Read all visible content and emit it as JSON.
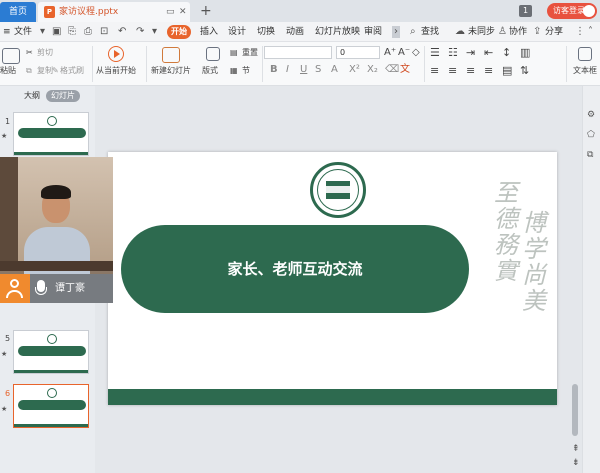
{
  "titlebar": {
    "home_tab": "首页",
    "file_tab": "家访议程.pptx",
    "ppt_badge": "P",
    "add_tab": "+",
    "page_badge": "1",
    "login_label": "访客登录"
  },
  "menu": {
    "hamburger": "≡",
    "file_label": "文件",
    "start": "开始",
    "tabs": [
      "插入",
      "设计",
      "切换",
      "动画",
      "幻灯片放映",
      "审阅"
    ],
    "search_label": "查找",
    "sync_label": "未同步",
    "collab_label": "协作",
    "share_label": "分享"
  },
  "ribbon": {
    "paste": "粘贴",
    "cut": "剪切",
    "copy": "复制",
    "format_painter": "格式刷",
    "play_from_current": "从当前开始",
    "new_slide": "新建幻灯片",
    "layout": "版式",
    "section": "节",
    "reset": "重置",
    "font_size": "0",
    "text_box": "文本框"
  },
  "leftpane": {
    "tab_outline": "大纲",
    "tab_slides": "幻灯片",
    "thumbnails": [
      {
        "num": "1"
      },
      {
        "num": "5"
      },
      {
        "num": "6"
      }
    ]
  },
  "webcam": {
    "name": "谭丁豪"
  },
  "slide": {
    "title": "家长、老师互动交流",
    "calligraphy_left": "至德務實",
    "calligraphy_right": "博学尚美"
  },
  "colors": {
    "accent": "#e8642c",
    "slide_green": "#2d6a4f",
    "home_tab_blue": "#2b7cd3"
  }
}
